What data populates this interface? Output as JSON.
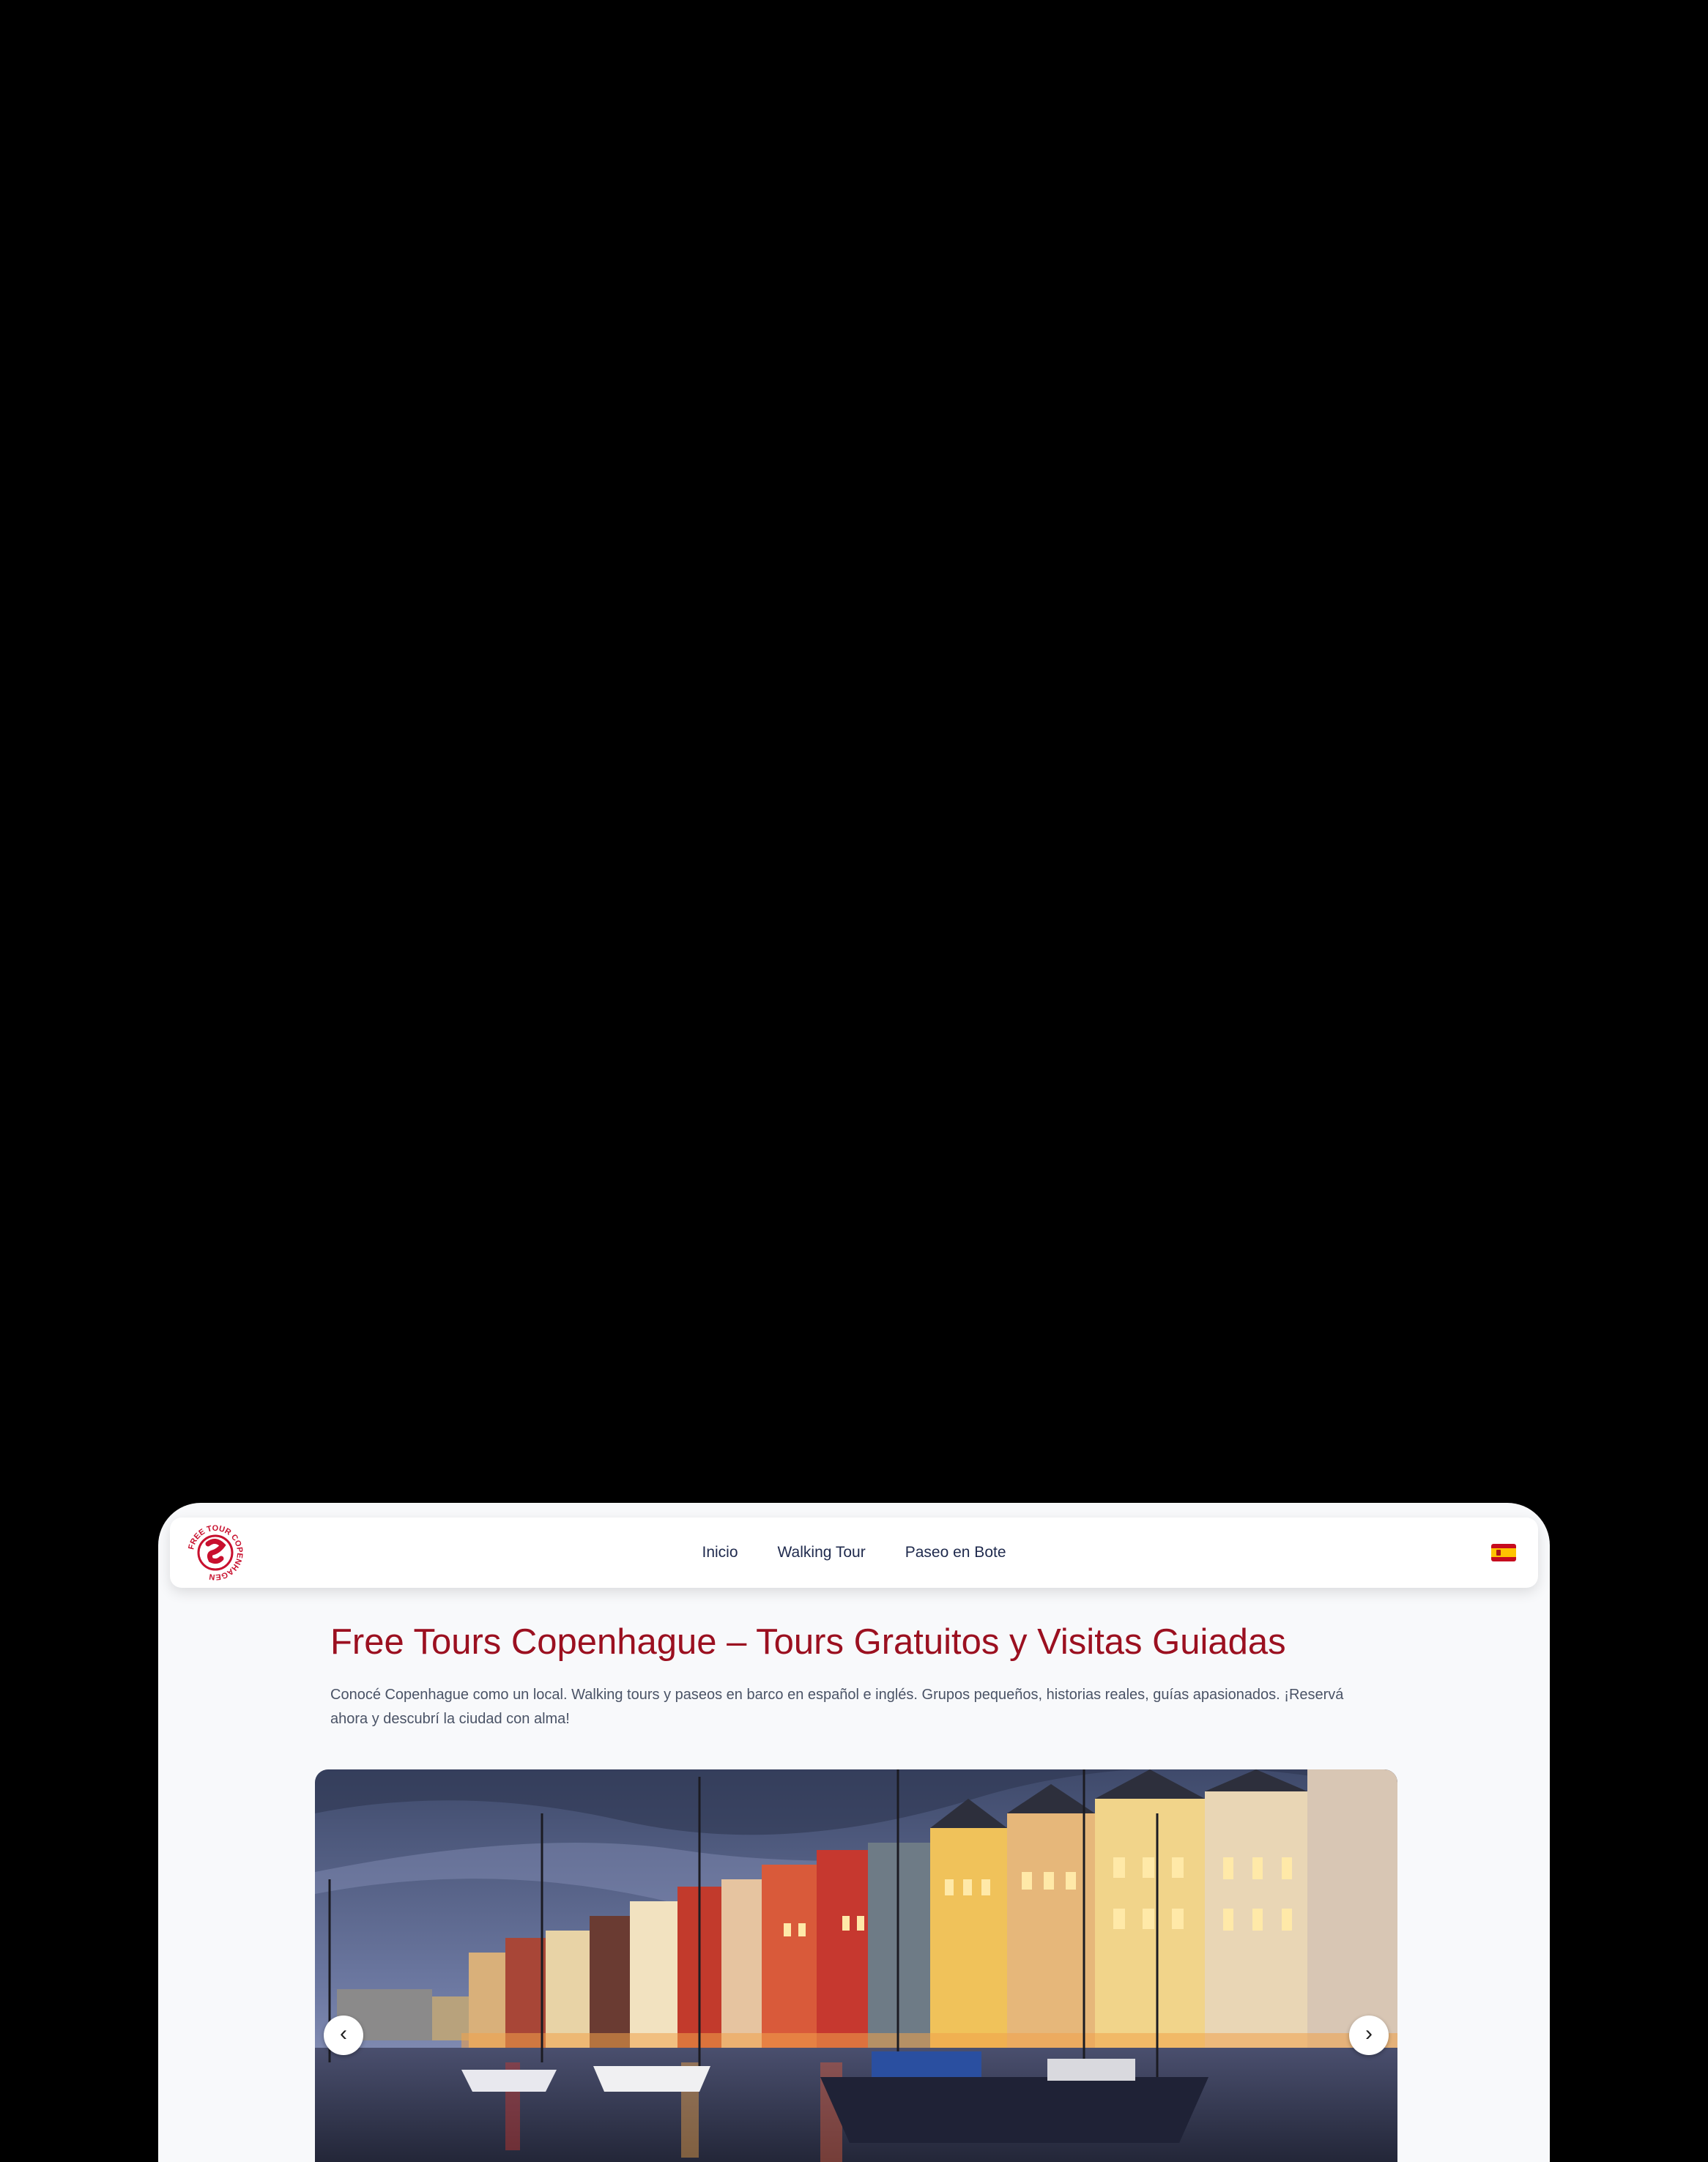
{
  "header": {
    "logo_text": "FREE TOUR COPENHAGEN",
    "nav": [
      {
        "label": "Inicio"
      },
      {
        "label": "Walking Tour"
      },
      {
        "label": "Paseo en Bote"
      }
    ],
    "language_flag": "spain-flag-icon"
  },
  "hero": {
    "title": "Free Tours Copenhague – Tours Gratuitos y Visitas Guiadas",
    "description": "Conocé Copenhague como un local. Walking tours y paseos en barco en español e inglés. Grupos pequeños, historias reales, guías apasionados. ¡Reservá ahora y descubrí la ciudad con alma!"
  },
  "carousel": {
    "prev_label": "‹",
    "next_label": "›",
    "image_subject": "nyhavn-canal-at-dusk"
  },
  "colors": {
    "brand_red": "#9b1020",
    "nav_text": "#1f2a4d",
    "body_text": "#4a5366",
    "page_bg": "#f8f9fb"
  }
}
